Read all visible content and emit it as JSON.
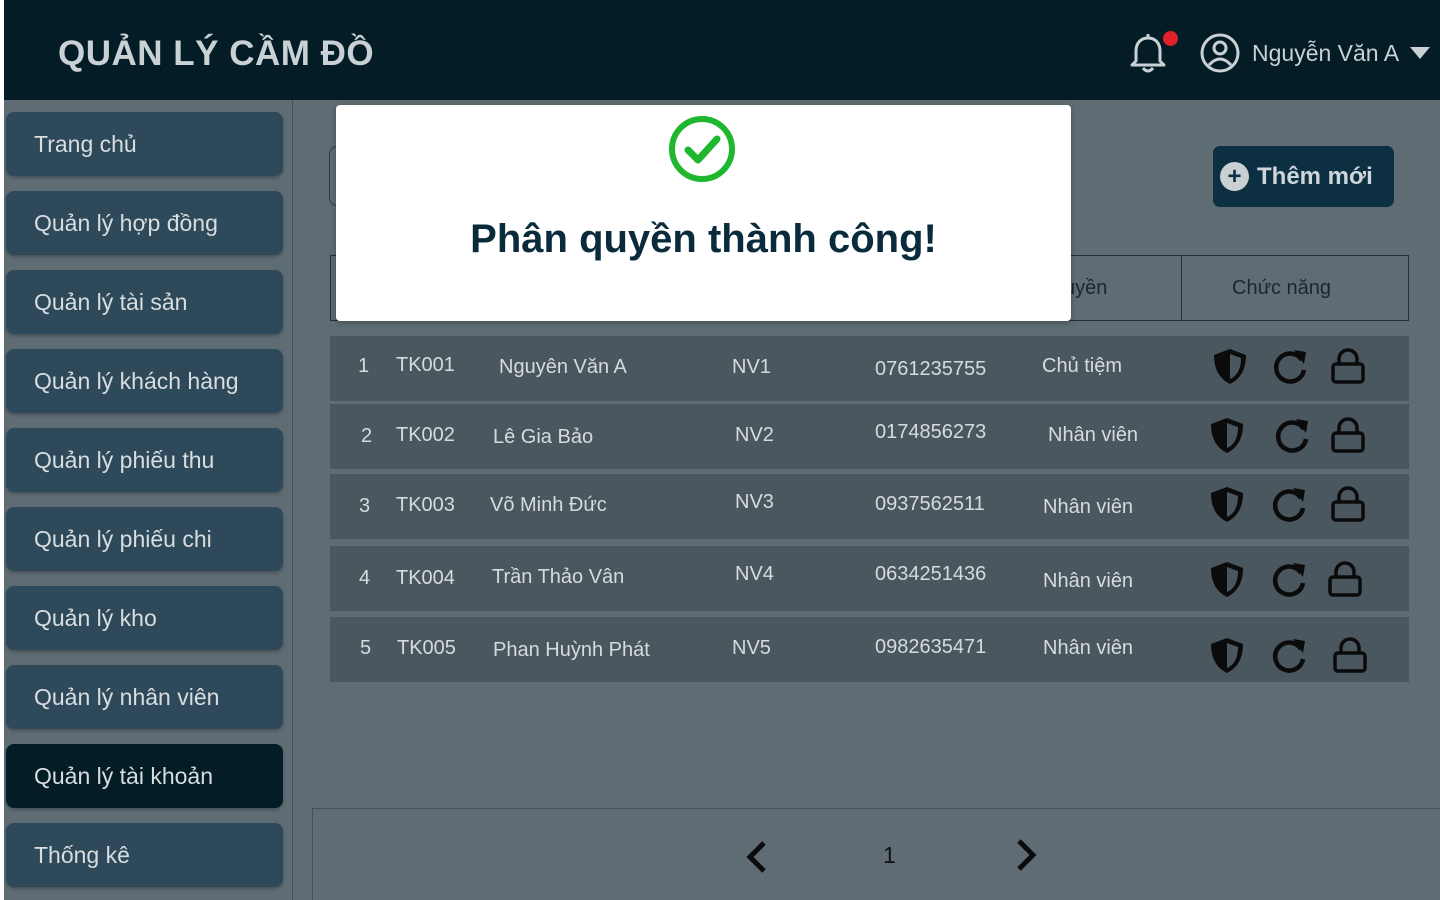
{
  "header": {
    "app_title": "QUẢN LÝ CẦM ĐỒ",
    "user_name": "Nguyễn Văn A",
    "icons": [
      "bell-icon",
      "user-avatar-icon",
      "caret-down-icon"
    ]
  },
  "sidebar": {
    "items": [
      {
        "label": "Trang chủ"
      },
      {
        "label": "Quản lý hợp đồng"
      },
      {
        "label": "Quản lý tài sản"
      },
      {
        "label": "Quản lý khách hàng"
      },
      {
        "label": "Quản lý phiếu thu"
      },
      {
        "label": "Quản lý phiếu chi"
      },
      {
        "label": "Quản lý kho"
      },
      {
        "label": "Quản lý nhân viên"
      },
      {
        "label": "Quản lý tài khoản"
      },
      {
        "label": "Thống kê"
      }
    ],
    "active_item": "Quản lý tài khoản"
  },
  "toolbar": {
    "add_label": "Thêm mới"
  },
  "table": {
    "visible_headers": [
      "uyền",
      "Chức năng"
    ],
    "rows": [
      {
        "stt": "1",
        "id": "TK001",
        "name": "Nguyên Văn A",
        "emp": "NV1",
        "phone": "0761235755",
        "role": "Chủ tiệm"
      },
      {
        "stt": "2",
        "id": "TK002",
        "name": "Lê Gia Bảo",
        "emp": "NV2",
        "phone": "0174856273",
        "role": "Nhân viên"
      },
      {
        "stt": "3",
        "id": "TK003",
        "name": "Võ Minh Đức",
        "emp": "NV3",
        "phone": "0937562511",
        "role": "Nhân viên"
      },
      {
        "stt": "4",
        "id": "TK004",
        "name": "Trần Thảo Vân",
        "emp": "NV4",
        "phone": "0634251436",
        "role": "Nhân viên"
      },
      {
        "stt": "5",
        "id": "TK005",
        "name": "Phan Huỳnh Phát",
        "emp": "NV5",
        "phone": "0982635471",
        "role": "Nhân viên"
      }
    ],
    "row_action_icons": [
      "shield-icon",
      "reset-icon",
      "lock-icon"
    ]
  },
  "pagination": {
    "current_page": "1"
  },
  "modal": {
    "message": "Phân quyền thành công!",
    "icon": "check-circle-icon"
  },
  "colors": {
    "header_bg": "#031c26",
    "nav_item": "#2e4a5a",
    "nav_active": "#031c26",
    "overlay_bg": "#5f6c74",
    "success_green": "#1fb72e",
    "notification_dot": "#e0212a"
  }
}
